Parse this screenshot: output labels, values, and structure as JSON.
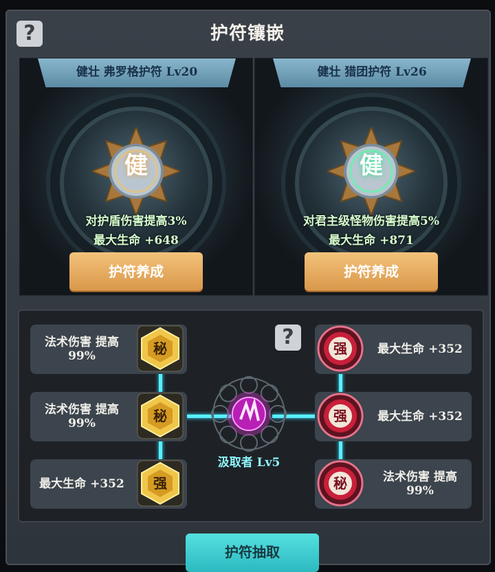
{
  "title": "护符镶嵌",
  "cards": [
    {
      "header": "健壮  弗罗格护符  Lv20",
      "glyph": "健",
      "effect": "对护盾伤害提高3%",
      "stat": "最大生命  +648",
      "button": "护符养成",
      "glow": "#e8c27a"
    },
    {
      "header": "健壮  猎团护符  Lv26",
      "glyph": "健",
      "effect": "对君主级怪物伤害提高5%",
      "stat": "最大生命  +871",
      "button": "护符养成",
      "glow": "#6cf0b0"
    }
  ],
  "left_slots": [
    {
      "line1": "法术伤害  提高",
      "line2": "99%",
      "gem": "秘"
    },
    {
      "line1": "法术伤害  提高",
      "line2": "99%",
      "gem": "秘"
    },
    {
      "line1": "最大生命  +352",
      "line2": "",
      "gem": "强"
    }
  ],
  "right_slots": [
    {
      "line1": "最大生命  +352",
      "line2": "",
      "gem": "强"
    },
    {
      "line1": "最大生命  +352",
      "line2": "",
      "gem": "强"
    },
    {
      "line1": "法术伤害  提高",
      "line2": "99%",
      "gem": "秘"
    }
  ],
  "center": {
    "label": "汲取者  Lv5",
    "icon": "claw-orb-icon"
  },
  "bottom_button": "护符抽取",
  "help_icon": "question-icon",
  "colors": {
    "gold": "#f0c64a",
    "red": "#c8203a",
    "link": "#57f0ff",
    "orb": "#e23ad8"
  }
}
